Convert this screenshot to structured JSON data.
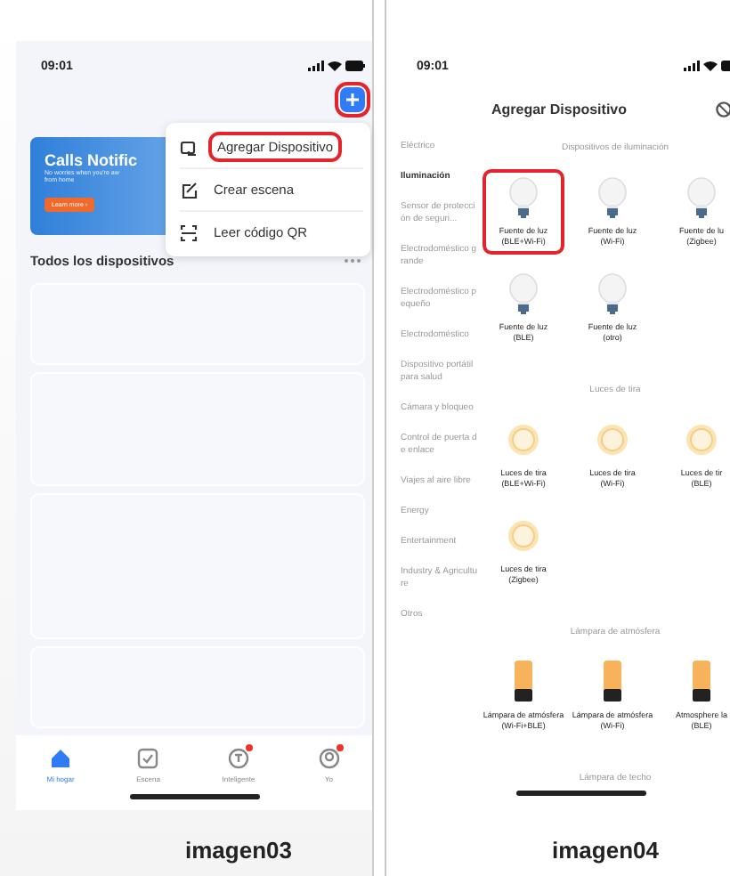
{
  "panels": [
    {
      "kind": "home",
      "caption": "imagen03",
      "status_time": "09:01",
      "add_button": {
        "highlighted": true
      },
      "banner": {
        "title": "Calls Notific",
        "lines": [
          "No worries when you're aw",
          "from home"
        ],
        "button": "Learn more ›"
      },
      "menu": [
        {
          "kind": "device",
          "label": "Agregar Dispositivo",
          "highlighted": true
        },
        {
          "kind": "scene",
          "label": "Crear escena",
          "highlighted": false
        },
        {
          "kind": "scan",
          "label": "Leer código QR",
          "highlighted": false
        }
      ],
      "section_title": "Todos los dispositivos",
      "nav": [
        {
          "kind": "home",
          "label": "Mi hogar",
          "selected": true,
          "badge": false
        },
        {
          "kind": "scene",
          "label": "Escena",
          "selected": false,
          "badge": false
        },
        {
          "kind": "smart",
          "label": "Inteligente",
          "selected": false,
          "badge": true
        },
        {
          "kind": "me",
          "label": "Yo",
          "selected": false,
          "badge": true
        }
      ]
    },
    {
      "kind": "catalog",
      "caption": "imagen04",
      "status_time": "09:01",
      "title": "Agregar Dispositivo",
      "categories": [
        {
          "label": "Eléctrico",
          "selected": false
        },
        {
          "label": "Iluminación",
          "selected": true
        },
        {
          "label": "Sensor de protección de seguri...",
          "selected": false
        },
        {
          "label": "Electrodoméstico grande",
          "selected": false
        },
        {
          "label": "Electrodoméstico pequeño",
          "selected": false
        },
        {
          "label": "Electrodoméstico",
          "selected": false
        },
        {
          "label": "Dispositivo portátil para salud",
          "selected": false
        },
        {
          "label": "Cámara y bloqueo",
          "selected": false
        },
        {
          "label": "Control de puerta de enlace",
          "selected": false
        },
        {
          "label": "Viajes al aire libre",
          "selected": false
        },
        {
          "label": "Energy",
          "selected": false
        },
        {
          "label": "Entertainment",
          "selected": false
        },
        {
          "label": "Industry & Agriculture",
          "selected": false
        },
        {
          "label": "Otros",
          "selected": false
        }
      ],
      "sections": [
        {
          "title": "Dispositivos de iluminación",
          "items": [
            {
              "kind": "bulb",
              "label": "Fuente de luz",
              "variant": "(BLE+Wi-Fi)",
              "highlighted": true
            },
            {
              "kind": "bulb",
              "label": "Fuente de luz",
              "variant": "(Wi-Fi)",
              "highlighted": false
            },
            {
              "kind": "bulb",
              "label": "Fuente de lu",
              "variant": "(Zigbee)",
              "highlighted": false
            },
            {
              "kind": "bulb",
              "label": "Fuente de luz",
              "variant": "(BLE)",
              "highlighted": false
            },
            {
              "kind": "bulb",
              "label": "Fuente de luz",
              "variant": "(otro)",
              "highlighted": false
            }
          ]
        },
        {
          "title": "Luces de tira",
          "items": [
            {
              "kind": "strip",
              "label": "Luces de tira",
              "variant": "(BLE+Wi-Fi)",
              "highlighted": false
            },
            {
              "kind": "strip",
              "label": "Luces de tira",
              "variant": "(Wi-Fi)",
              "highlighted": false
            },
            {
              "kind": "strip",
              "label": "Luces de tir",
              "variant": "(BLE)",
              "highlighted": false
            },
            {
              "kind": "strip",
              "label": "Luces de tira",
              "variant": "(Zigbee)",
              "highlighted": false
            }
          ]
        },
        {
          "title": "Lámpara de atmósfera",
          "items": [
            {
              "kind": "lamp",
              "label": "Lámpara de atmósfera",
              "variant": "(Wi-Fi+BLE)",
              "highlighted": false
            },
            {
              "kind": "lamp",
              "label": "Lámpara de atmósfera",
              "variant": "(Wi-Fi)",
              "highlighted": false
            },
            {
              "kind": "lamp",
              "label": "Atmosphere la",
              "variant": "(BLE)",
              "highlighted": false
            }
          ]
        },
        {
          "title": "Lámpara de techo"
        }
      ]
    }
  ]
}
